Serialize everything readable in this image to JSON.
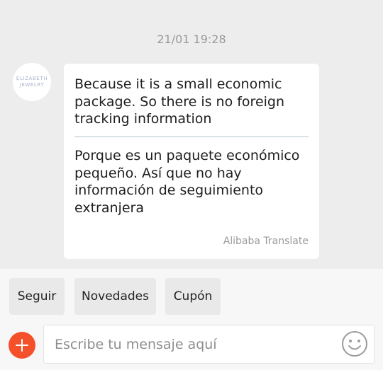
{
  "conversation": {
    "timestamp": "21/01 19:28",
    "sender_avatar": {
      "line1": "ELIZABETH",
      "line2": "JEWELRY"
    },
    "message": {
      "original_text": "Because it is a small economic package. So there is no foreign tracking information",
      "translated_text": "Porque es un paquete económico pequeño. Así que no hay información de seguimiento extranjera",
      "translation_credit": "Alibaba Translate"
    }
  },
  "quick_replies": [
    {
      "label": "Seguir"
    },
    {
      "label": "Novedades"
    },
    {
      "label": "Cupón"
    }
  ],
  "composer": {
    "placeholder": "Escribe tu mensaje aquí",
    "add_icon": "plus-icon",
    "emoji_icon": "smiley-icon"
  },
  "colors": {
    "accent": "#f4502a",
    "background": "#ededed",
    "bubble": "#ffffff",
    "divider": "#d6e3e6"
  }
}
